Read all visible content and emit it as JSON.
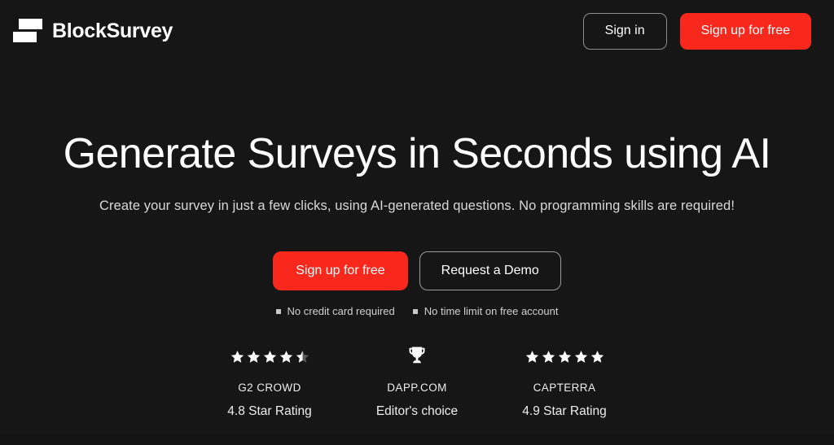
{
  "theme": {
    "background": "#161616",
    "accent_red": "#f8291c",
    "text_primary": "#ffffff",
    "text_secondary": "#d8d8d8",
    "border": "#8e8e8e"
  },
  "header": {
    "brand_name": "BlockSurvey",
    "logo_icon": "blocksurvey-logo-icon",
    "sign_in_label": "Sign in",
    "sign_up_label": "Sign up for free"
  },
  "hero": {
    "headline": "Generate Surveys in Seconds using AI",
    "subheadline": "Create your survey in just a few clicks, using AI-generated questions. No programming skills are required!",
    "primary_cta": "Sign up for free",
    "secondary_cta": "Request a Demo",
    "notes": [
      "No credit card required",
      "No time limit on free account"
    ]
  },
  "badges": [
    {
      "icon": "star-rating-icon",
      "rating": 4.5,
      "stars_total": 5,
      "title": "G2 CROWD",
      "subtitle": "4.8 Star Rating"
    },
    {
      "icon": "trophy-icon",
      "title": "DAPP.COM",
      "subtitle": "Editor's choice"
    },
    {
      "icon": "star-rating-icon",
      "rating": 5,
      "stars_total": 5,
      "title": "CAPTERRA",
      "subtitle": "4.9 Star Rating"
    }
  ]
}
